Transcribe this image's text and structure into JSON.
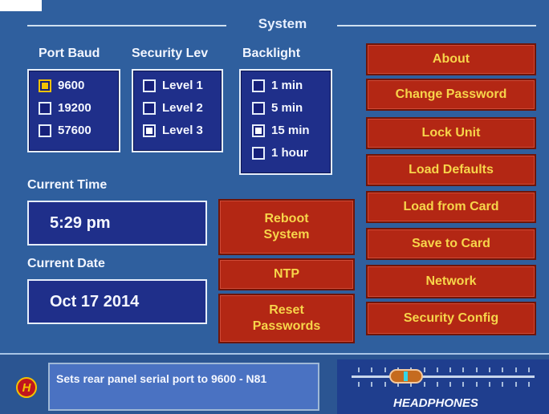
{
  "window": {
    "title": "System"
  },
  "port_baud": {
    "label": "Port Baud",
    "options": [
      {
        "label": "9600",
        "checked": true
      },
      {
        "label": "19200",
        "checked": false
      },
      {
        "label": "57600",
        "checked": false
      }
    ]
  },
  "security_level": {
    "label": "Security Lev",
    "options": [
      {
        "label": "Level 1",
        "checked": false
      },
      {
        "label": "Level 2",
        "checked": false
      },
      {
        "label": "Level 3",
        "checked": true
      }
    ]
  },
  "backlight": {
    "label": "Backlight",
    "options": [
      {
        "label": "1 min",
        "checked": false
      },
      {
        "label": "5 min",
        "checked": false
      },
      {
        "label": "15 min",
        "checked": true
      },
      {
        "label": "1 hour",
        "checked": false
      }
    ]
  },
  "current_time": {
    "label": "Current Time",
    "value": "5:29 pm"
  },
  "current_date": {
    "label": "Current Date",
    "value": "Oct 17 2014"
  },
  "buttons": {
    "reboot_line1": "Reboot",
    "reboot_line2": "System",
    "ntp": "NTP",
    "reset_line1": "Reset",
    "reset_line2": "Passwords",
    "about": "About",
    "change_password": "Change Password",
    "lock_unit": "Lock Unit",
    "load_defaults": "Load Defaults",
    "load_from_card": "Load from Card",
    "save_to_card": "Save to Card",
    "network": "Network",
    "security_config": "Security Config"
  },
  "status": {
    "help_icon_letter": "H",
    "message": "Sets rear panel serial port to 9600 - N81"
  },
  "headphones": {
    "label": "HEADPHONES",
    "level": 0.25
  },
  "colors": {
    "background": "#2f5f9e",
    "panel": "#1f2f8a",
    "button": "#b32714",
    "button_text": "#f7d54a",
    "accent_yellow": "#f2c200"
  }
}
